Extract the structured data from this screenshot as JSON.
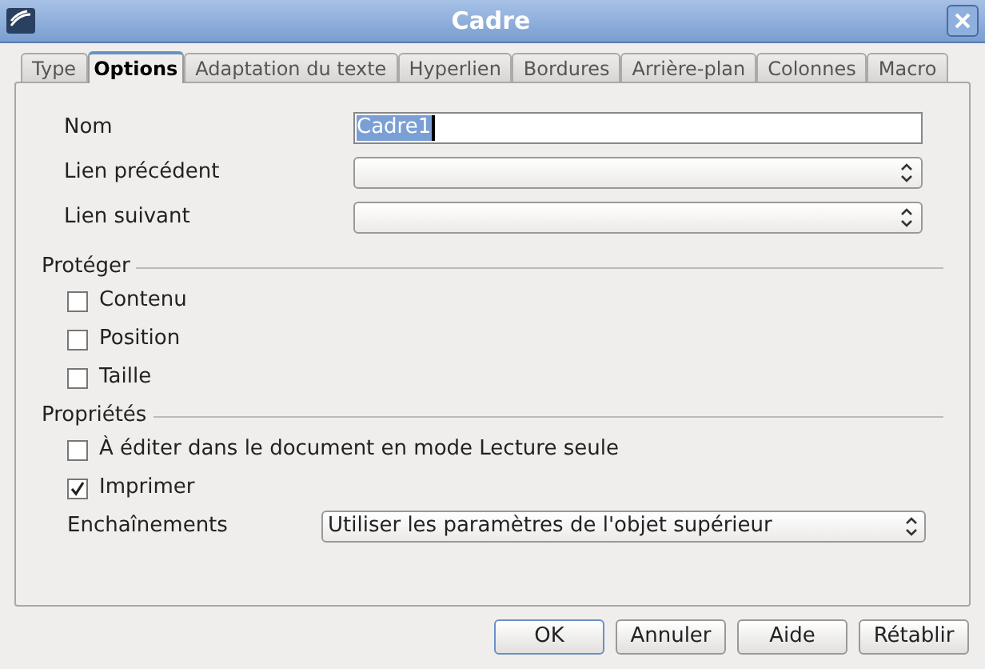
{
  "window": {
    "title": "Cadre"
  },
  "tabs": [
    {
      "label": "Type",
      "selected": false
    },
    {
      "label": "Options",
      "selected": true
    },
    {
      "label": "Adaptation du texte",
      "selected": false
    },
    {
      "label": "Hyperlien",
      "selected": false
    },
    {
      "label": "Bordures",
      "selected": false
    },
    {
      "label": "Arrière-plan",
      "selected": false
    },
    {
      "label": "Colonnes",
      "selected": false
    },
    {
      "label": "Macro",
      "selected": false
    }
  ],
  "fields": [
    {
      "label": "Nom",
      "kind": "text",
      "value": "Cadre1"
    },
    {
      "label": "Lien précédent",
      "kind": "spin"
    },
    {
      "label": "Lien suivant",
      "kind": "spin"
    }
  ],
  "protect": {
    "title": "Protéger",
    "options": [
      {
        "label": "Contenu",
        "checked": false
      },
      {
        "label": "Position",
        "checked": false
      },
      {
        "label": "Taille",
        "checked": false
      }
    ]
  },
  "properties": {
    "title": "Propriétés",
    "options": [
      {
        "label": "À éditer dans le document en mode Lecture seule",
        "checked": false
      },
      {
        "label": "Imprimer",
        "checked": true
      }
    ],
    "select": {
      "label": "Enchaînements",
      "value": "Utiliser les paramètres de l'objet supérieur"
    }
  },
  "buttons": [
    {
      "label": "OK",
      "default": true
    },
    {
      "label": "Annuler",
      "default": false
    },
    {
      "label": "Aide",
      "default": false
    },
    {
      "label": "Rétablir",
      "default": false
    }
  ]
}
